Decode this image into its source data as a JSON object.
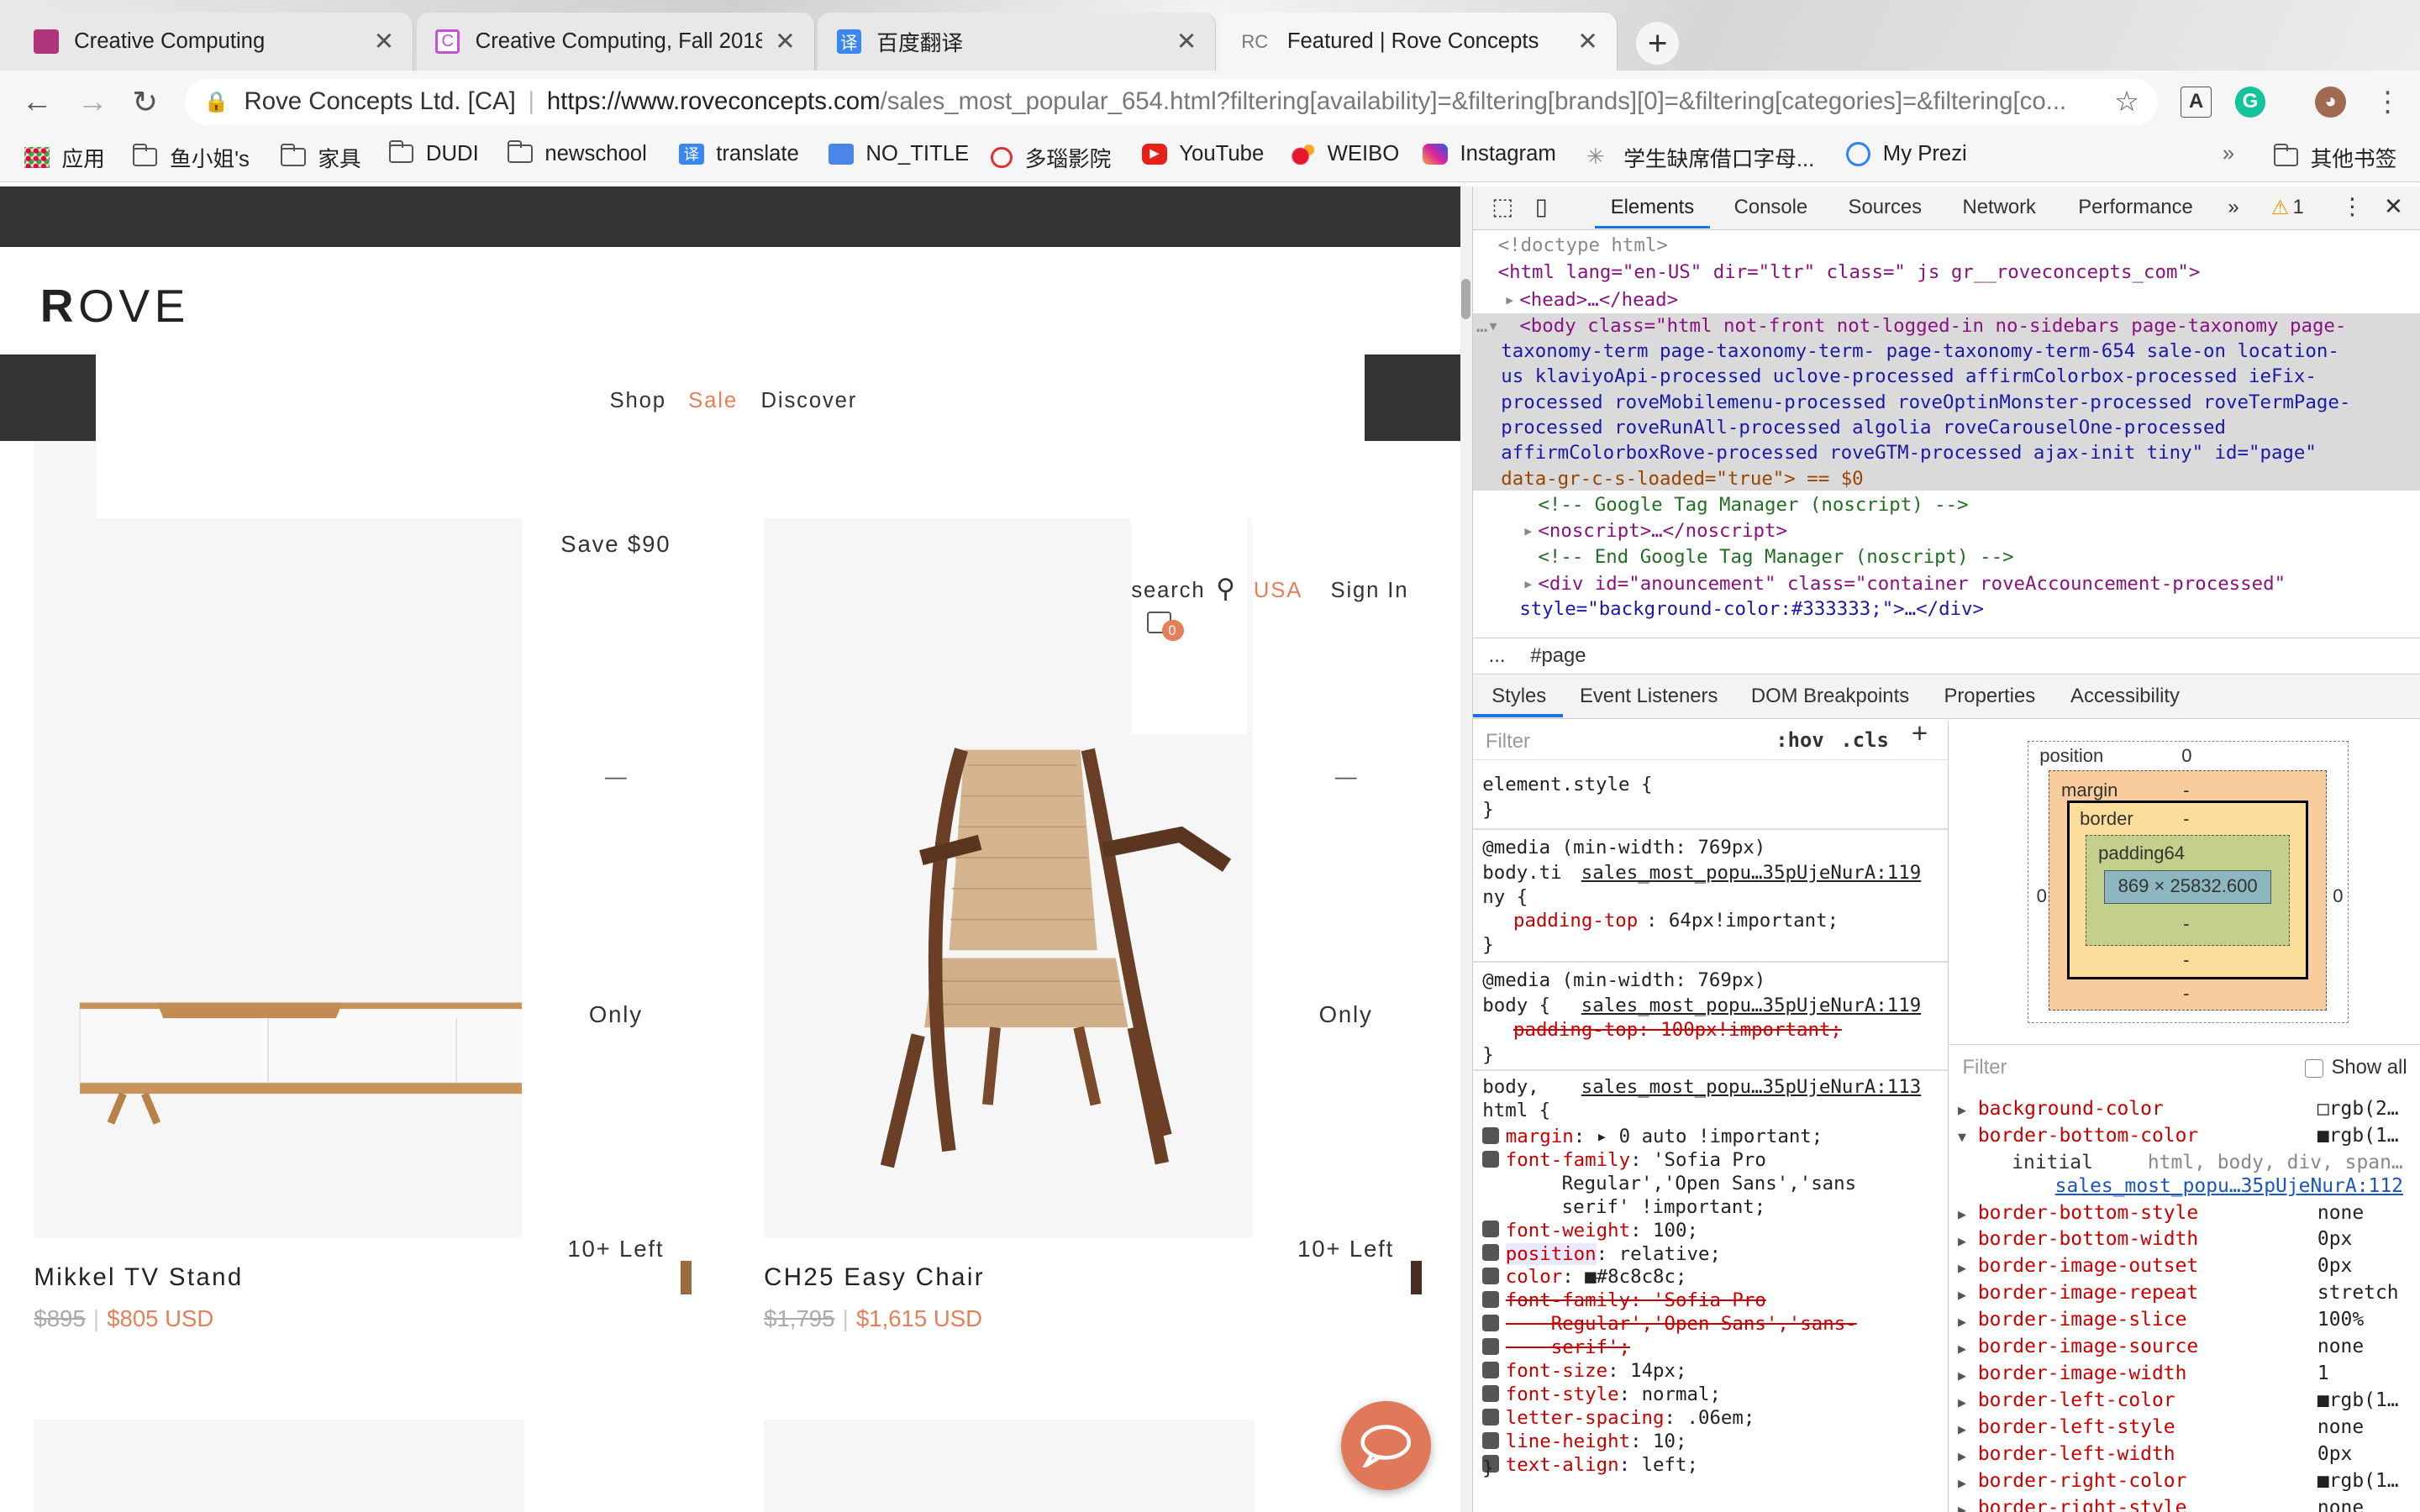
{
  "browser": {
    "tabs": [
      {
        "title": "Creative Computing",
        "favicon": "square-icon",
        "color": "#b0357a"
      },
      {
        "title": "Creative Computing, Fall 2018",
        "favicon": "c-logo-icon",
        "color": "#c64fd8"
      },
      {
        "title": "百度翻译",
        "favicon": "translate-icon",
        "color": "#3b86f0"
      },
      {
        "title": "Featured | Rove Concepts",
        "favicon": "rc-icon",
        "color": "#777777"
      }
    ],
    "address": {
      "site_name": "Rove Concepts Ltd. [CA]",
      "domain": "https://www.roveconcepts.com",
      "path": "/sales_most_popular_654.html?filtering[availability]=&filtering[brands][0]=&filtering[categories]=&filtering[co..."
    },
    "bookmarks": [
      {
        "label": "应用",
        "icon": "apps-icon"
      },
      {
        "label": "鱼小姐's",
        "icon": "folder-icon"
      },
      {
        "label": "家具",
        "icon": "folder-icon"
      },
      {
        "label": "DUDI",
        "icon": "folder-icon"
      },
      {
        "label": "newschool",
        "icon": "folder-icon"
      },
      {
        "label": "translate",
        "icon": "translate-icon"
      },
      {
        "label": "NO_TITLE",
        "icon": "google-translate-icon"
      },
      {
        "label": "多瑙影院",
        "icon": "cinema-icon"
      },
      {
        "label": "YouTube",
        "icon": "youtube-icon"
      },
      {
        "label": "WEIBO",
        "icon": "weibo-icon"
      },
      {
        "label": "Instagram",
        "icon": "instagram-icon"
      },
      {
        "label": "学生缺席借口字母...",
        "icon": "star-icon"
      },
      {
        "label": "My Prezi",
        "icon": "prezi-icon"
      }
    ],
    "other_bookmarks": "其他书签",
    "chevron": "»"
  },
  "site": {
    "logo_bold": "R",
    "logo_rest": "OVE",
    "nav": [
      "Shop",
      "Sale",
      "Discover"
    ],
    "search_label": "search",
    "region": "USA",
    "sign_in": "Sign In",
    "cart_count": "0",
    "accent": "#e57f5a",
    "products": [
      {
        "name": "Mikkel TV Stand",
        "old_price": "$895",
        "new_price": "$805 USD",
        "save": "Save $90",
        "dash": "—",
        "only": "Only",
        "stock": "10+ Left",
        "swatch": "#9b6a3e"
      },
      {
        "name": "CH25 Easy Chair",
        "old_price": "$1,795",
        "new_price": "$1,615 USD",
        "save": "",
        "dash": "—",
        "only": "Only",
        "stock": "10+ Left",
        "swatch": "#4a2e22"
      }
    ]
  },
  "devtools": {
    "tabs": [
      "Elements",
      "Console",
      "Sources",
      "Network",
      "Performance",
      "»"
    ],
    "warning_count": "1",
    "dom": {
      "doctype": "<!doctype html>",
      "html_open": "<html lang=\"en-US\" dir=\"ltr\" class=\" js gr__roveconcepts_com\">",
      "head": "<head>…</head>",
      "body": [
        "<body class=\"html not-front not-logged-in no-sidebars page-taxonomy page-",
        "taxonomy-term page-taxonomy-term- page-taxonomy-term-654 sale-on location-",
        "us klaviyoApi-processed uclove-processed affirmColorbox-processed ieFix-",
        "processed roveMobilemenu-processed roveOptinMonster-processed roveTermPage-",
        "processed roveRunAll-processed algolia roveCarouselOne-processed",
        "affirmColorboxRove-processed roveGTM-processed ajax-init tiny\" id=\"page\"",
        "data-gr-c-s-loaded=\"true\"> == $0"
      ],
      "gtm_comment": "<!-- Google Tag Manager (noscript) -->",
      "noscript": "<noscript>…</noscript>",
      "gtm_end": "<!-- End Google Tag Manager (noscript) -->",
      "div_line1": "<div id=\"anouncement\" class=\"container roveAccouncement-processed\"",
      "div_line2": "style=\"background-color:#333333;\">…</div>"
    },
    "breadcrumb": [
      "...",
      "#page"
    ],
    "subtabs": [
      "Styles",
      "Event Listeners",
      "DOM Breakpoints",
      "Properties",
      "Accessibility"
    ],
    "filter_placeholder": "Filter",
    "hov": ":hov",
    "cls": ".cls",
    "styles": {
      "element_style": "element.style {",
      "close": "}",
      "rule1": {
        "media": "@media (min-width: 769px)",
        "selector": "body.ti",
        "selector2": "ny {",
        "source": "sales_most_popu…35pUjeNurA:119",
        "prop": "padding-top",
        "value": ": 64px!important;"
      },
      "rule2": {
        "media": "@media (min-width: 769px)",
        "selector": "body {",
        "source": "sales_most_popu…35pUjeNurA:119",
        "prop": "padding-top: 100px!important;"
      },
      "rule3": {
        "selector": "body,",
        "selector2": "html {",
        "source": "sales_most_popu…35pUjeNurA:113",
        "props": [
          {
            "name": "margin",
            "value": ": ▸ 0 auto !important;"
          },
          {
            "name": "font-family",
            "value": ": 'Sofia Pro"
          },
          {
            "name": "",
            "value": "    Regular','Open Sans','sans"
          },
          {
            "name": "",
            "value": "    serif' !important;"
          },
          {
            "name": "font-weight",
            "value": ": 100;"
          },
          {
            "name": "position",
            "value": ": relative;"
          },
          {
            "name": "color",
            "value": ": ■#8c8c8c;"
          },
          {
            "name": "font-family: 'Sofia Pro",
            "value": ""
          },
          {
            "name": "    Regular','Open Sans','sans-",
            "value": ""
          },
          {
            "name": "    serif';",
            "value": ""
          },
          {
            "name": "font-size",
            "value": ": 14px;"
          },
          {
            "name": "font-style",
            "value": ": normal;"
          },
          {
            "name": "letter-spacing",
            "value": ": .06em;"
          },
          {
            "name": "line-height",
            "value": ": 10;"
          },
          {
            "name": "text-align",
            "value": ": left;"
          }
        ]
      }
    },
    "boxmodel": {
      "position_label": "position",
      "position_value": "0",
      "margin_label": "margin",
      "margin_value": "-",
      "border_label": "border",
      "border_value": "-",
      "padding_label": "padding64",
      "padding_value": "-",
      "content": "869 × 25832.600",
      "side_left": "0",
      "side_right": "0",
      "dash": "-"
    },
    "computed": {
      "filter": "Filter",
      "show_all": "Show all",
      "rows": [
        {
          "name": "background-color",
          "value": "□rgb(2…",
          "open": false
        },
        {
          "name": "border-bottom-color",
          "value": "■rgb(1…",
          "open": true
        },
        {
          "name": "border-bottom-style",
          "value": "none",
          "open": false
        },
        {
          "name": "border-bottom-width",
          "value": "0px",
          "open": false
        },
        {
          "name": "border-image-outset",
          "value": "0px",
          "open": false
        },
        {
          "name": "border-image-repeat",
          "value": "stretch",
          "open": false
        },
        {
          "name": "border-image-slice",
          "value": "100%",
          "open": false
        },
        {
          "name": "border-image-source",
          "value": "none",
          "open": false
        },
        {
          "name": "border-image-width",
          "value": "1",
          "open": false
        },
        {
          "name": "border-left-color",
          "value": "■rgb(1…",
          "open": false
        },
        {
          "name": "border-left-style",
          "value": "none",
          "open": false
        },
        {
          "name": "border-left-width",
          "value": "0px",
          "open": false
        },
        {
          "name": "border-right-color",
          "value": "■rgb(1…",
          "open": false
        },
        {
          "name": "border-right-style",
          "value": "none",
          "open": false
        }
      ],
      "initial_label": "initial",
      "initial_selectors": "html, body, div, span…",
      "initial_source": "sales_most_popu…35pUjeNurA:112"
    }
  }
}
